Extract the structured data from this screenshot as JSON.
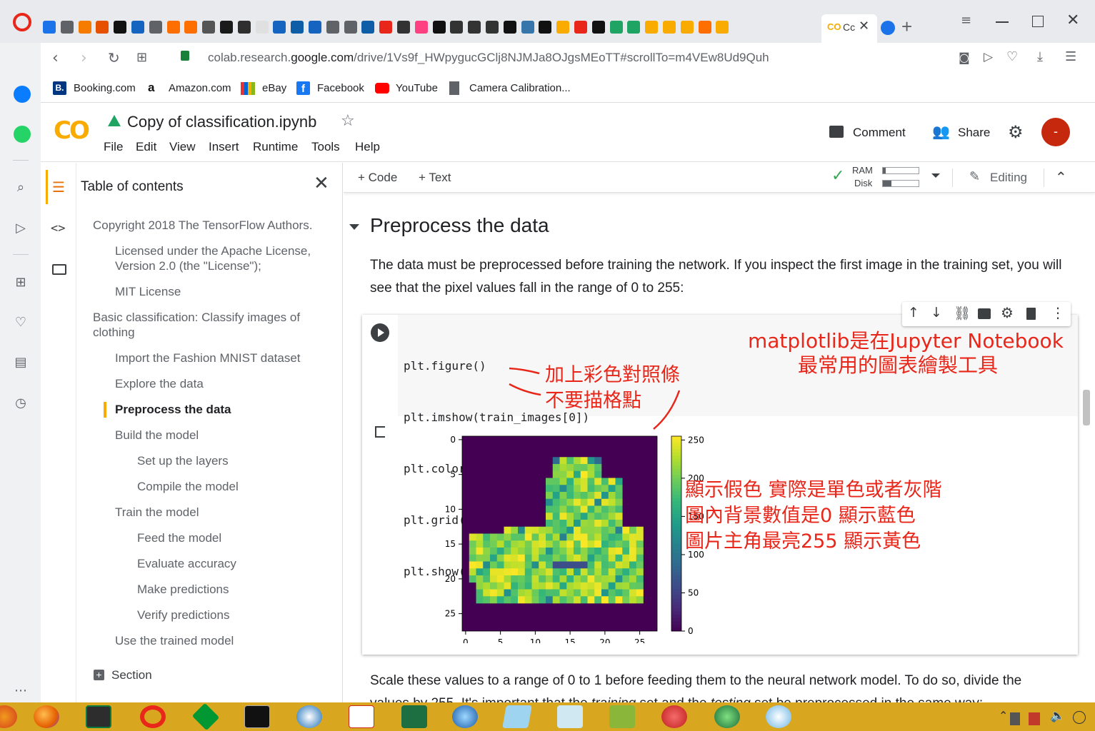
{
  "browser": {
    "active_tab_label": "Cc",
    "new_tab": "+",
    "url_host_prefix": "colab.research.",
    "url_host": "google.com",
    "url_path": "/drive/1Vs9f_HWpygucGClj8NJMJa8OJgsMEoTT#scrollTo=m4VEw8Ud9Quh",
    "bookmarks": [
      "Booking.com",
      "Amazon.com",
      "eBay",
      "Facebook",
      "YouTube",
      "Camera Calibration..."
    ]
  },
  "colab": {
    "logo": "CO",
    "notebook_title": "Copy of classification.ipynb",
    "menu": [
      "File",
      "Edit",
      "View",
      "Insert",
      "Runtime",
      "Tools",
      "Help"
    ],
    "comment_label": "Comment",
    "share_label": "Share",
    "avatar_letter": "-",
    "add_code": "+ Code",
    "add_text": "+ Text",
    "ram_label": "RAM",
    "disk_label": "Disk",
    "editing_label": "Editing"
  },
  "toc": {
    "title": "Table of contents",
    "items": [
      {
        "label": "Copyright 2018 The TensorFlow Authors."
      },
      {
        "label": "Licensed under the Apache License, Version 2.0 (the \"License\");"
      },
      {
        "label": "MIT License"
      },
      {
        "label": "Basic classification: Classify images of clothing"
      },
      {
        "label": "Import the Fashion MNIST dataset"
      },
      {
        "label": "Explore the data"
      },
      {
        "label": "Preprocess the data"
      },
      {
        "label": "Build the model"
      },
      {
        "label": "Set up the layers"
      },
      {
        "label": "Compile the model"
      },
      {
        "label": "Train the model"
      },
      {
        "label": "Feed the model"
      },
      {
        "label": "Evaluate accuracy"
      },
      {
        "label": "Make predictions"
      },
      {
        "label": "Verify predictions"
      },
      {
        "label": "Use the trained model"
      }
    ],
    "section_label": "Section"
  },
  "notebook": {
    "heading": "Preprocess the data",
    "para1": "The data must be preprocessed before training the network. If you inspect the first image in the training set, you will see that the pixel values fall in the range of 0 to 255:",
    "code_lines": [
      "plt.figure()",
      "plt.imshow(train_images[0])",
      "plt.colorbar()",
      "plt.grid(False)",
      "plt.show()"
    ],
    "para2_line1": "Scale these values to a range of 0 to 1 before feeding them to the neural network model. To do so, divide the",
    "para2_line2": "values by 255. It's important that the training set and the testing set be preprocessed in the same way:",
    "annotations": {
      "matplotlib_line1": "matplotlib是在Jupyter Notebook",
      "matplotlib_line2": "最常用的圖表繪製工具",
      "colorbar": "加上彩色對照條",
      "grid": "不要描格點",
      "false_color_1": "顯示假色 實際是單色或者灰階",
      "false_color_2": "圖內背景數值是0 顯示藍色",
      "false_color_3": "圖片主角最亮255 顯示黃色"
    }
  },
  "chart_data": {
    "type": "heatmap",
    "title": "",
    "x_ticks": [
      "0",
      "5",
      "10",
      "15",
      "20",
      "25"
    ],
    "y_ticks": [
      "0",
      "5",
      "10",
      "15",
      "20",
      "25"
    ],
    "colorbar_ticks": [
      "0",
      "50",
      "100",
      "150",
      "200",
      "250"
    ],
    "vmin": 0,
    "vmax": 255,
    "colormap": "viridis",
    "size": [
      28,
      28
    ]
  }
}
